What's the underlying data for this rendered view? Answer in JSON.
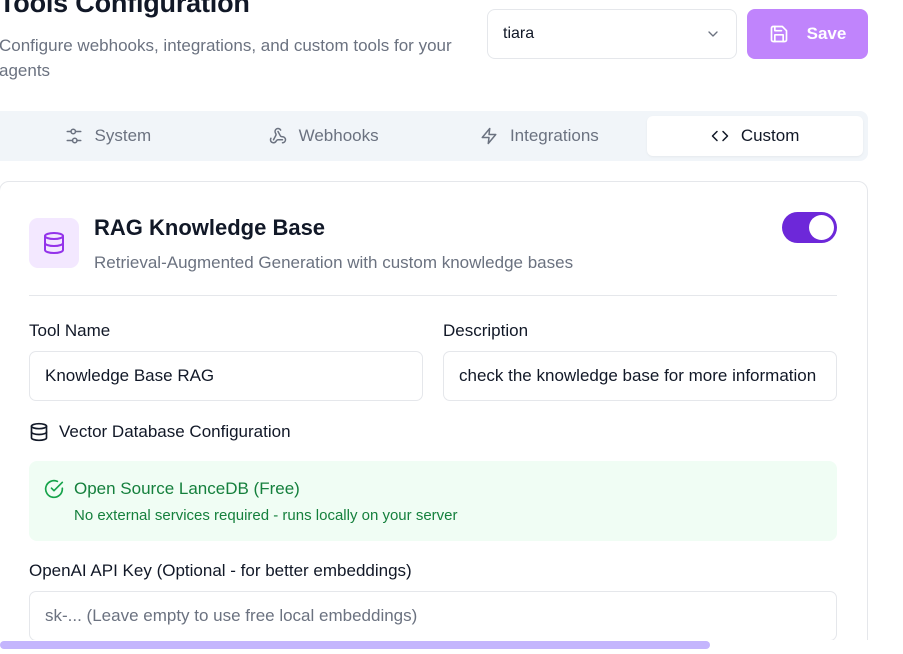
{
  "header": {
    "title": "Tools Configuration",
    "subtitle": "Configure webhooks, integrations, and custom tools for your agents"
  },
  "agent_select": {
    "value": "tiara",
    "icon": "chevron-down-icon"
  },
  "save_button": {
    "label": "Save",
    "icon": "save-icon",
    "color": "#c084fc"
  },
  "tabs": [
    {
      "label": "System",
      "icon": "sliders-icon",
      "active": false
    },
    {
      "label": "Webhooks",
      "icon": "webhook-icon",
      "active": false
    },
    {
      "label": "Integrations",
      "icon": "zap-icon",
      "active": false
    },
    {
      "label": "Custom",
      "icon": "code-icon",
      "active": true
    }
  ],
  "rag": {
    "title": "RAG Knowledge Base",
    "subtitle": "Retrieval-Augmented Generation with custom knowledge bases",
    "icon": "database-icon",
    "enabled": true,
    "toggle_color": "#6d28d9"
  },
  "form": {
    "tool_name_label": "Tool Name",
    "tool_name_value": "Knowledge Base RAG",
    "description_label": "Description",
    "description_value": "check the knowledge base for more information",
    "vector_db_label": "Vector Database Configuration",
    "vector_db_icon": "database-icon",
    "notice_title": "Open Source LanceDB (Free)",
    "notice_description": "No external services required - runs locally on your server",
    "notice_icon": "check-circle-icon",
    "notice_color": "#15803d",
    "api_key_label": "OpenAI API Key (Optional - for better embeddings)",
    "api_key_placeholder": "sk-... (Leave empty to use free local embeddings)",
    "api_key_value": ""
  }
}
